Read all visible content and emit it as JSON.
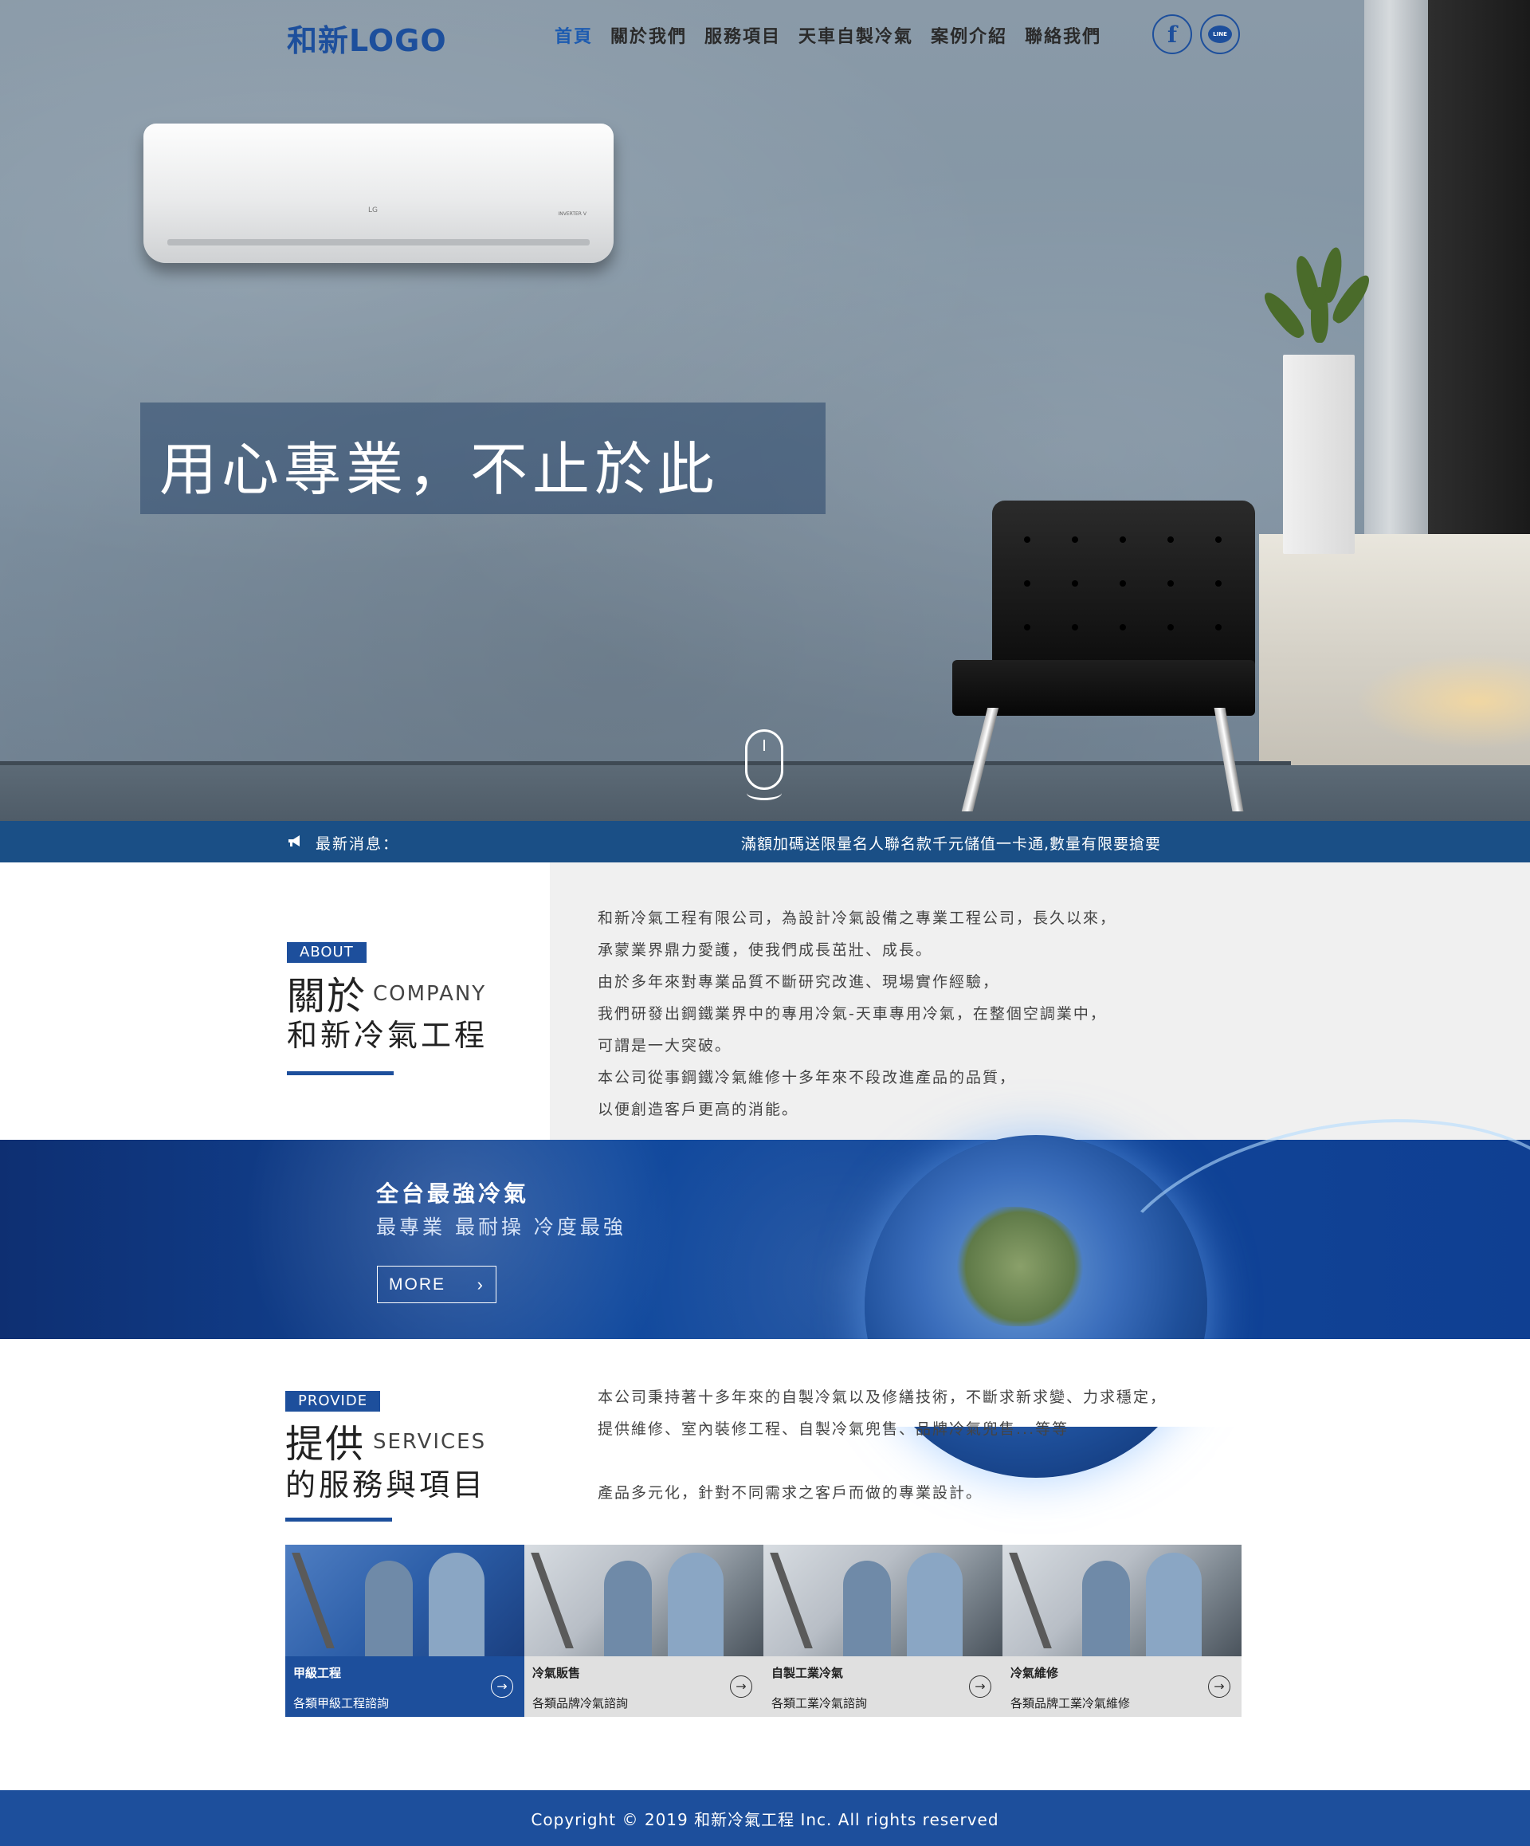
{
  "header": {
    "logo": "和新LOGO",
    "nav": [
      "首頁",
      "關於我們",
      "服務項目",
      "天車自製冷氣",
      "案例介紹",
      "聯絡我們"
    ],
    "social": [
      {
        "name": "facebook",
        "glyph": "f"
      },
      {
        "name": "line",
        "glyph": "LINE"
      }
    ]
  },
  "hero": {
    "tagline": "用心專業，不止於此",
    "ac_brand": "LG",
    "ac_model": "INVERTER V"
  },
  "news": {
    "label": "最新消息：",
    "message": "滿額加碼送限量名人聯名款千元儲值一卡通,數量有限要搶要"
  },
  "about": {
    "tag": "ABOUT",
    "title_cn": "關於",
    "title_en": "COMPANY",
    "subtitle": "和新冷氣工程",
    "lines": [
      "和新冷氣工程有限公司，為設計冷氣設備之專業工程公司，長久以來，",
      "承蒙業界鼎力愛護，使我們成長茁壯、成長。",
      "由於多年來對專業品質不斷研究改進、現場實作經驗，",
      "我們研發出鋼鐵業界中的專用冷氣-天車專用冷氣，在整個空調業中，",
      "可謂是一大突破。",
      "本公司從事鋼鐵冷氣維修十多年來不段改進產品的品質，",
      "以便創造客戶更高的消能。"
    ]
  },
  "banner": {
    "title": "全台最強冷氣",
    "subtitle": "最專業 最耐操 冷度最強",
    "more_label": "MORE",
    "more_arrow": "›"
  },
  "services": {
    "tag": "PROVIDE",
    "title_cn": "提供",
    "title_en": "SERVICES",
    "subtitle": "的服務與項目",
    "lines": [
      "本公司秉持著十多年來的自製冷氣以及修繕技術，不斷求新求變、力求穩定，",
      "提供維修、室內裝修工程、自製冷氣兜售、品牌冷氣兜售...等等",
      "",
      "產品多元化，針對不同需求之客戶而做的專業設計。"
    ],
    "cards": [
      {
        "title": "甲級工程",
        "desc": "各類甲級工程諮詢",
        "arrow": "→"
      },
      {
        "title": "冷氣販售",
        "desc": "各類品牌冷氣諮詢",
        "arrow": "→"
      },
      {
        "title": "自製工業冷氣",
        "desc": "各類工業冷氣諮詢",
        "arrow": "→"
      },
      {
        "title": "冷氣維修",
        "desc": "各類品牌工業冷氣維修",
        "arrow": "→"
      }
    ]
  },
  "footer": {
    "copyright": "Copyright © 2019 和新冷氣工程 Inc. All rights reserved"
  },
  "colors": {
    "brand_blue": "#1d4f9c",
    "news_bar": "#1a4f86",
    "about_bg": "#f0f0f0",
    "card_inactive": "#e0e0e0"
  }
}
